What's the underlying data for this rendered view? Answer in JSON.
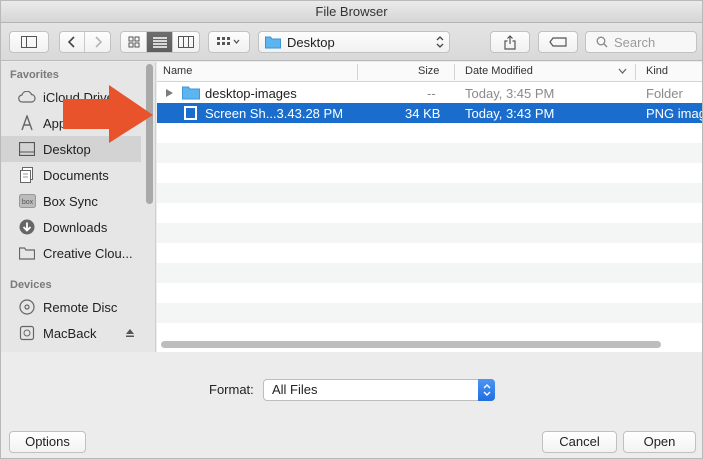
{
  "window": {
    "title": "File Browser"
  },
  "toolbar": {
    "location": "Desktop",
    "search_placeholder": "Search"
  },
  "sidebar": {
    "favorites_heading": "Favorites",
    "favorites": [
      {
        "label": "iCloud Drive",
        "icon": "cloud-icon"
      },
      {
        "label": "Applications",
        "icon": "applications-icon"
      },
      {
        "label": "Desktop",
        "icon": "desktop-icon",
        "selected": true
      },
      {
        "label": "Documents",
        "icon": "documents-icon"
      },
      {
        "label": "Box Sync",
        "icon": "box-icon"
      },
      {
        "label": "Downloads",
        "icon": "downloads-icon"
      },
      {
        "label": "Creative Clou...",
        "icon": "folder-icon"
      }
    ],
    "devices_heading": "Devices",
    "devices": [
      {
        "label": "Remote Disc",
        "icon": "disc-icon"
      },
      {
        "label": "MacBack",
        "icon": "drive-icon"
      }
    ]
  },
  "files": {
    "columns": [
      "Name",
      "Size",
      "Date Modified",
      "Kind"
    ],
    "rows": [
      {
        "name": "desktop-images",
        "size": "--",
        "date": "Today, 3:45 PM",
        "kind": "Folder"
      },
      {
        "name": "Screen Sh...3.43.28 PM",
        "size": "34 KB",
        "date": "Today, 3:43 PM",
        "kind": "PNG image"
      }
    ]
  },
  "format": {
    "label": "Format:",
    "value": "All Files"
  },
  "buttons": {
    "options": "Options",
    "cancel": "Cancel",
    "open": "Open"
  },
  "colors": {
    "selection": "#1a6dcc",
    "arrow": "#e8532b",
    "folder": "#5db5ef"
  }
}
